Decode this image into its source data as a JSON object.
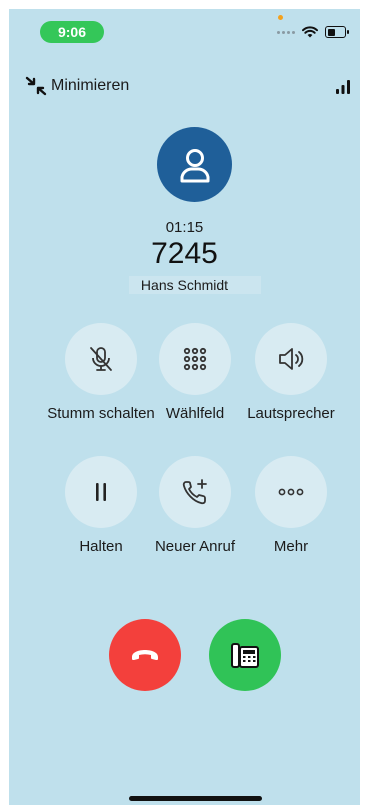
{
  "status_bar": {
    "time": "9:06",
    "icons": [
      "signal-dots-icon",
      "wifi-icon",
      "battery-icon"
    ]
  },
  "header": {
    "minimize_label": "Minimieren",
    "minimize_icon": "minimize-arrows-icon",
    "signal_icon": "signal-bars-icon"
  },
  "call": {
    "avatar_icon": "user-icon",
    "duration": "01:15",
    "number": "7245",
    "name": "Hans Schmidt"
  },
  "controls": {
    "mute": {
      "label": "Stumm schalten",
      "icon": "microphone-off-icon"
    },
    "keypad": {
      "label": "Wählfeld",
      "icon": "keypad-icon"
    },
    "speaker": {
      "label": "Lautsprecher",
      "icon": "speaker-icon"
    },
    "hold": {
      "label": "Halten",
      "icon": "pause-icon"
    },
    "new_call": {
      "label": "Neuer Anruf",
      "icon": "add-call-icon"
    },
    "more": {
      "label": "Mehr",
      "icon": "more-icon"
    }
  },
  "actions": {
    "end_call_icon": "hang-up-icon",
    "desk_phone_icon": "desk-phone-icon"
  },
  "colors": {
    "background": "#bfe0ec",
    "avatar": "#1f5f99",
    "end_call": "#f3403c",
    "desk_phone": "#30c357",
    "time_pill": "#34c759"
  }
}
